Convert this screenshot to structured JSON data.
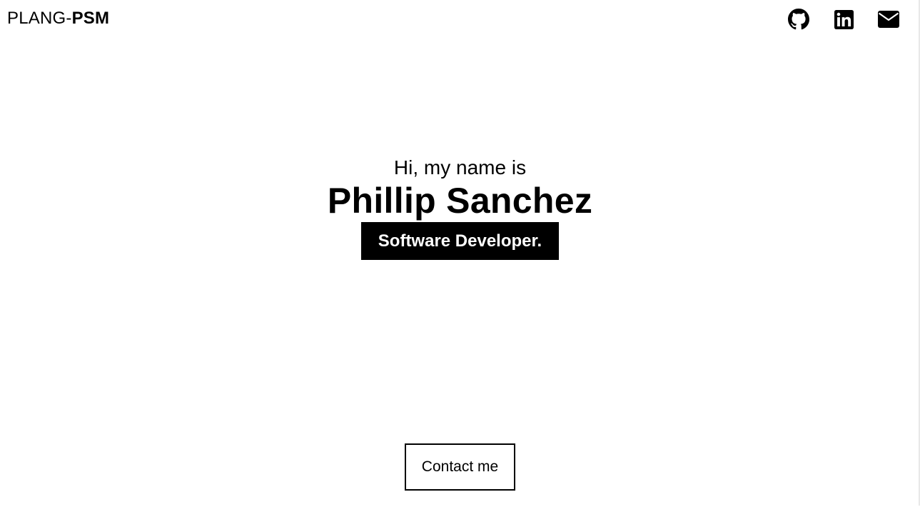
{
  "header": {
    "brand_light": "PLANG-",
    "brand_bold": "PSM",
    "social_icons": [
      "github-icon",
      "linkedin-icon",
      "envelope-icon"
    ]
  },
  "hero": {
    "greeting": "Hi, my name is",
    "name": "Phillip Sanchez",
    "role": "Software Developer."
  },
  "actions": {
    "contact_label": "Contact me"
  },
  "colors": {
    "background": "#ffffff",
    "text": "#000000",
    "role_background": "#000000",
    "role_text": "#ffffff"
  }
}
